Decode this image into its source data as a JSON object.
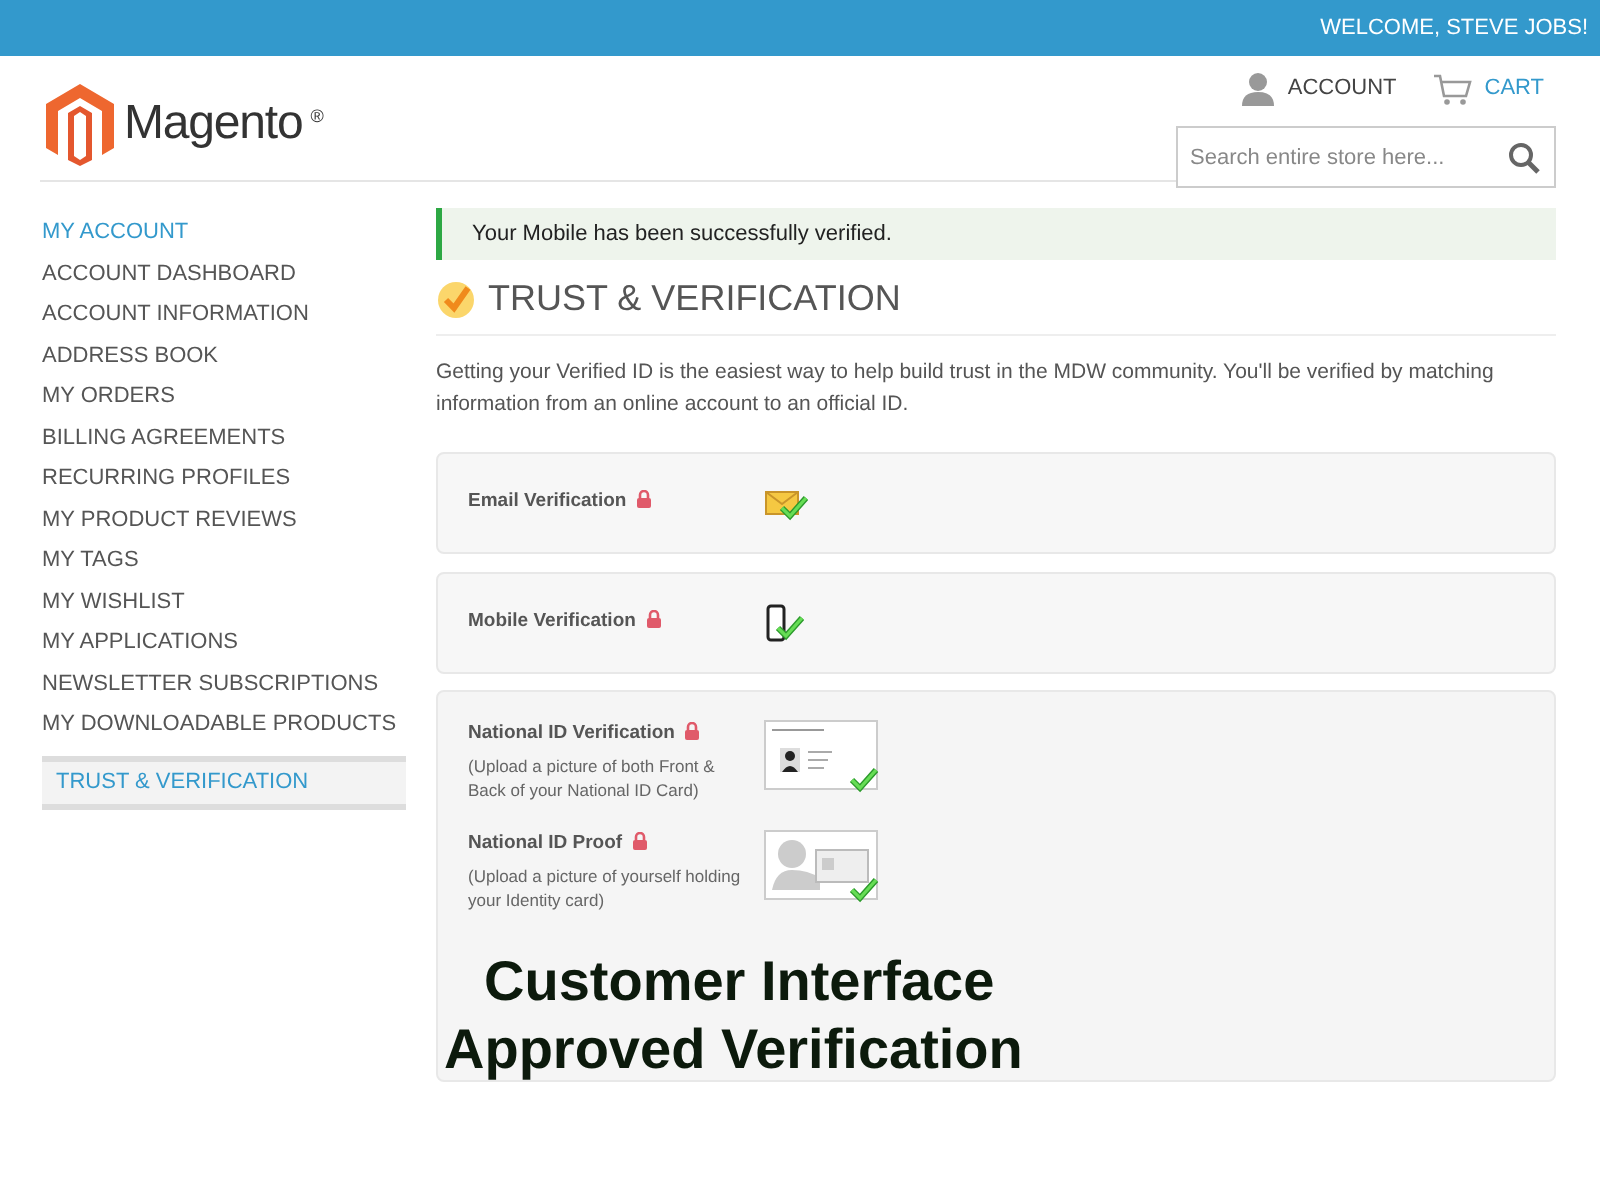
{
  "top_bar": {
    "welcome": "WELCOME, STEVE JOBS!"
  },
  "header": {
    "logo": "Magento",
    "logo_mark": "®",
    "account": "ACCOUNT",
    "cart": "CART",
    "search": {
      "placeholder": "Search entire store here..."
    }
  },
  "sidebar": {
    "heading": "MY ACCOUNT",
    "items": [
      {
        "label": "ACCOUNT DASHBOARD",
        "selected": false
      },
      {
        "label": "ACCOUNT INFORMATION",
        "selected": false
      },
      {
        "label": "ADDRESS BOOK",
        "selected": false
      },
      {
        "label": "MY ORDERS",
        "selected": false
      },
      {
        "label": "BILLING AGREEMENTS",
        "selected": false
      },
      {
        "label": "RECURRING PROFILES",
        "selected": false
      },
      {
        "label": "MY PRODUCT REVIEWS",
        "selected": false
      },
      {
        "label": "MY TAGS",
        "selected": false
      },
      {
        "label": "MY WISHLIST",
        "selected": false
      },
      {
        "label": "MY APPLICATIONS",
        "selected": false
      },
      {
        "label": "NEWSLETTER SUBSCRIPTIONS",
        "selected": false
      },
      {
        "label": "MY DOWNLOADABLE PRODUCTS",
        "selected": false
      },
      {
        "label": "TRUST & VERIFICATION",
        "selected": true
      }
    ]
  },
  "alert": "Your Mobile has been successfully verified.",
  "title": "TRUST & VERIFICATION",
  "intro": "Getting your Verified ID is the easiest way to help build trust in the MDW community. You'll be verified by matching information from an online account to an official ID.",
  "verifications": [
    {
      "kind": "email",
      "label": "Email Verification",
      "verified": true
    },
    {
      "kind": "mobile",
      "label": "Mobile Verification",
      "verified": true
    },
    {
      "kind": "id_card",
      "label": "National ID Verification",
      "description": "(Upload a picture of both Front & Back of your National ID Card)",
      "verified": true
    },
    {
      "kind": "selfie",
      "label": "National ID Proof",
      "description": "(Upload a picture of yourself holding your Identity card)",
      "verified": true
    }
  ],
  "caption": [
    "Customer Interface",
    "Approved Verification"
  ]
}
